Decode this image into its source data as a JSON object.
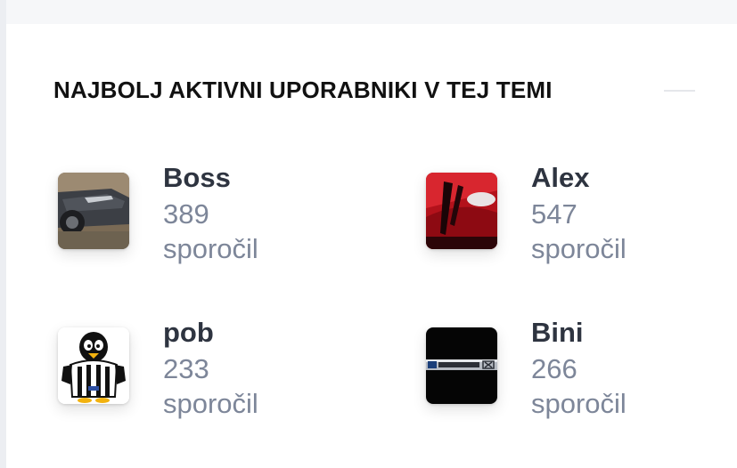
{
  "section": {
    "title": "NAJBOLJ AKTIVNI UPORABNIKI V TEJ TEMI"
  },
  "users": [
    {
      "name": "Boss",
      "count": "389",
      "unit": "sporočil",
      "avatar_icon": "car-photo-icon"
    },
    {
      "name": "Alex",
      "count": "547",
      "unit": "sporočil",
      "avatar_icon": "red-car-photo-icon"
    },
    {
      "name": "pob",
      "count": "233",
      "unit": "sporočil",
      "avatar_icon": "penguin-icon"
    },
    {
      "name": "Bini",
      "count": "266",
      "unit": "sporočil",
      "avatar_icon": "skyactiv-badge-icon"
    }
  ],
  "colors": {
    "name": "#2e3440",
    "meta": "#7d8699",
    "heading": "#111111"
  }
}
